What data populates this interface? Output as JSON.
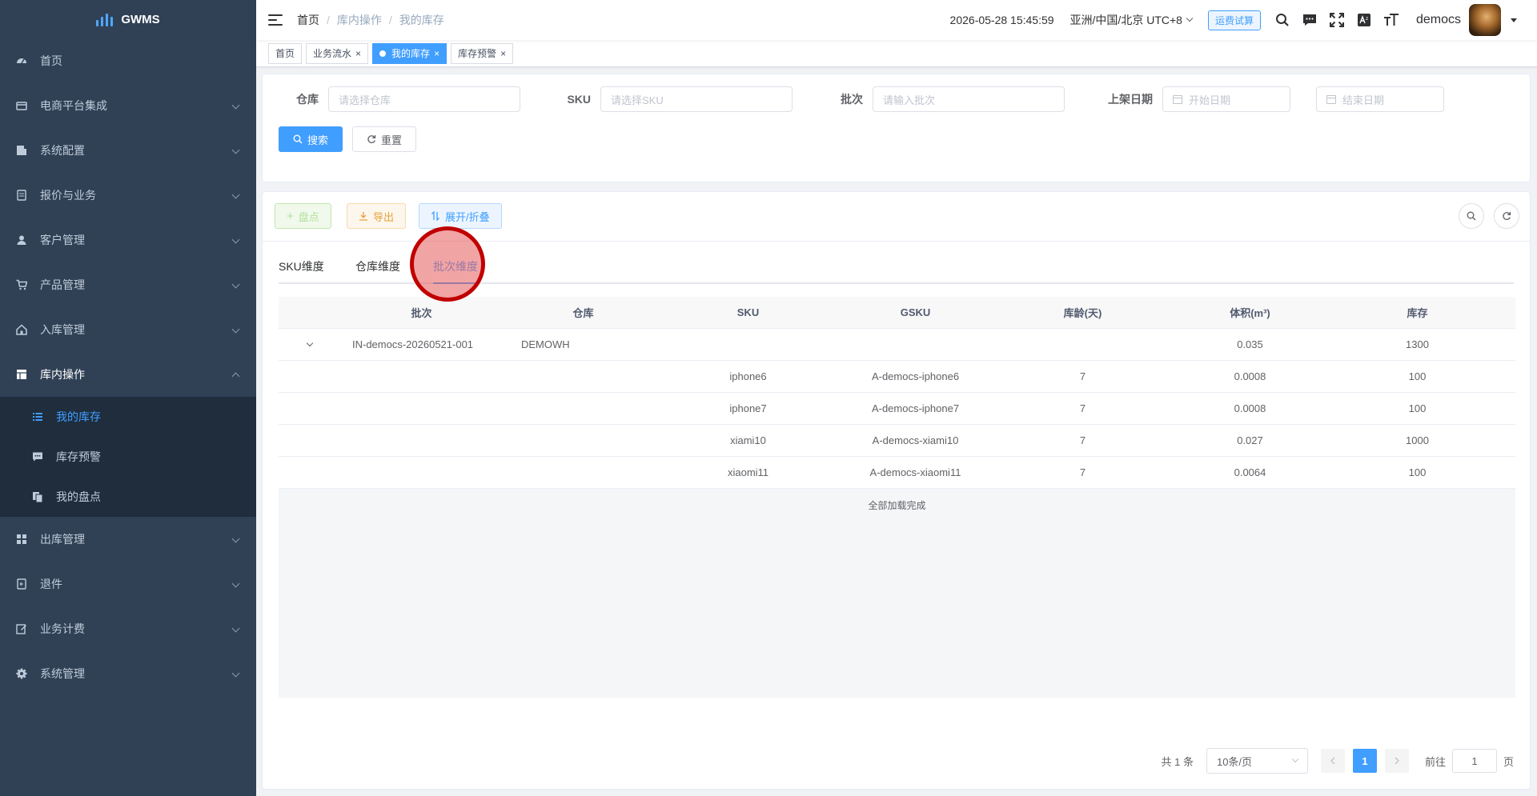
{
  "app": {
    "name": "GWMS"
  },
  "sidebar": {
    "items": [
      {
        "label": "首页",
        "icon": "dashboard-icon",
        "has_children": false
      },
      {
        "label": "电商平台集成",
        "icon": "store-icon",
        "has_children": true
      },
      {
        "label": "系统配置",
        "icon": "config-icon",
        "has_children": true
      },
      {
        "label": "报价与业务",
        "icon": "quote-icon",
        "has_children": true
      },
      {
        "label": "客户管理",
        "icon": "user-icon",
        "has_children": true
      },
      {
        "label": "产品管理",
        "icon": "cart-icon",
        "has_children": true
      },
      {
        "label": "入库管理",
        "icon": "home-icon",
        "has_children": true
      },
      {
        "label": "库内操作",
        "icon": "table-icon",
        "has_children": true,
        "open": true
      },
      {
        "label": "出库管理",
        "icon": "grid-icon",
        "has_children": true
      },
      {
        "label": "退件",
        "icon": "return-icon",
        "has_children": true
      },
      {
        "label": "业务计费",
        "icon": "edit-icon",
        "has_children": true
      },
      {
        "label": "系统管理",
        "icon": "gear-icon",
        "has_children": true
      }
    ],
    "sub_items": [
      {
        "label": "我的库存",
        "icon": "list-icon",
        "active": true
      },
      {
        "label": "库存预警",
        "icon": "message-icon",
        "active": false
      },
      {
        "label": "我的盘点",
        "icon": "copy-icon",
        "active": false
      }
    ]
  },
  "header": {
    "breadcrumb": [
      "首页",
      "库内操作",
      "我的库存"
    ],
    "datetime": "2026-05-28 15:45:59",
    "timezone": "亚洲/中国/北京 UTC+8",
    "fee_button": "运费试算",
    "username": "democs"
  },
  "tags": [
    {
      "label": "首页",
      "closable": false,
      "active": false
    },
    {
      "label": "业务流水",
      "closable": true,
      "active": false
    },
    {
      "label": "我的库存",
      "closable": true,
      "active": true
    },
    {
      "label": "库存预警",
      "closable": true,
      "active": false
    }
  ],
  "search": {
    "warehouse": {
      "label": "仓库",
      "placeholder": "请选择仓库"
    },
    "sku": {
      "label": "SKU",
      "placeholder": "请选择SKU"
    },
    "batch": {
      "label": "批次",
      "placeholder": "请输入批次"
    },
    "shelf_date": {
      "label": "上架日期",
      "start_placeholder": "开始日期",
      "end_placeholder": "结束日期"
    },
    "search_button": "搜索",
    "reset_button": "重置"
  },
  "toolbar": {
    "count_button": "盘点",
    "export_button": "导出",
    "expand_button": "展开/折叠"
  },
  "tabs": [
    "SKU维度",
    "仓库维度",
    "批次维度"
  ],
  "active_tab": "批次维度",
  "table": {
    "columns": [
      "批次",
      "仓库",
      "SKU",
      "GSKU",
      "库龄(天)",
      "体积(m³)",
      "库存"
    ],
    "parent_row": {
      "batch": "IN-democs-20260521-001",
      "warehouse": "DEMOWH",
      "sku": "",
      "gsku": "",
      "age": "",
      "volume": "0.035",
      "stock": "1300"
    },
    "child_rows": [
      {
        "sku": "iphone6",
        "gsku": "A-democs-iphone6",
        "age": "7",
        "volume": "0.0008",
        "stock": "100"
      },
      {
        "sku": "iphone7",
        "gsku": "A-democs-iphone7",
        "age": "7",
        "volume": "0.0008",
        "stock": "100"
      },
      {
        "sku": "xiami10",
        "gsku": "A-democs-xiami10",
        "age": "7",
        "volume": "0.027",
        "stock": "1000"
      },
      {
        "sku": "xiaomi11",
        "gsku": "A-democs-xiaomi11",
        "age": "7",
        "volume": "0.0064",
        "stock": "100"
      }
    ],
    "load_status": "全部加载完成"
  },
  "pagination": {
    "total": "共 1 条",
    "page_size": "10条/页",
    "current_page": "1",
    "goto_label": "前往",
    "goto_value": "1",
    "page_suffix": "页"
  },
  "colors": {
    "primary": "#409eff",
    "sidebar_bg": "#304156",
    "submenu_bg": "#1f2d3d",
    "warning": "#e6a23c",
    "success_light": "#b3e19d"
  }
}
